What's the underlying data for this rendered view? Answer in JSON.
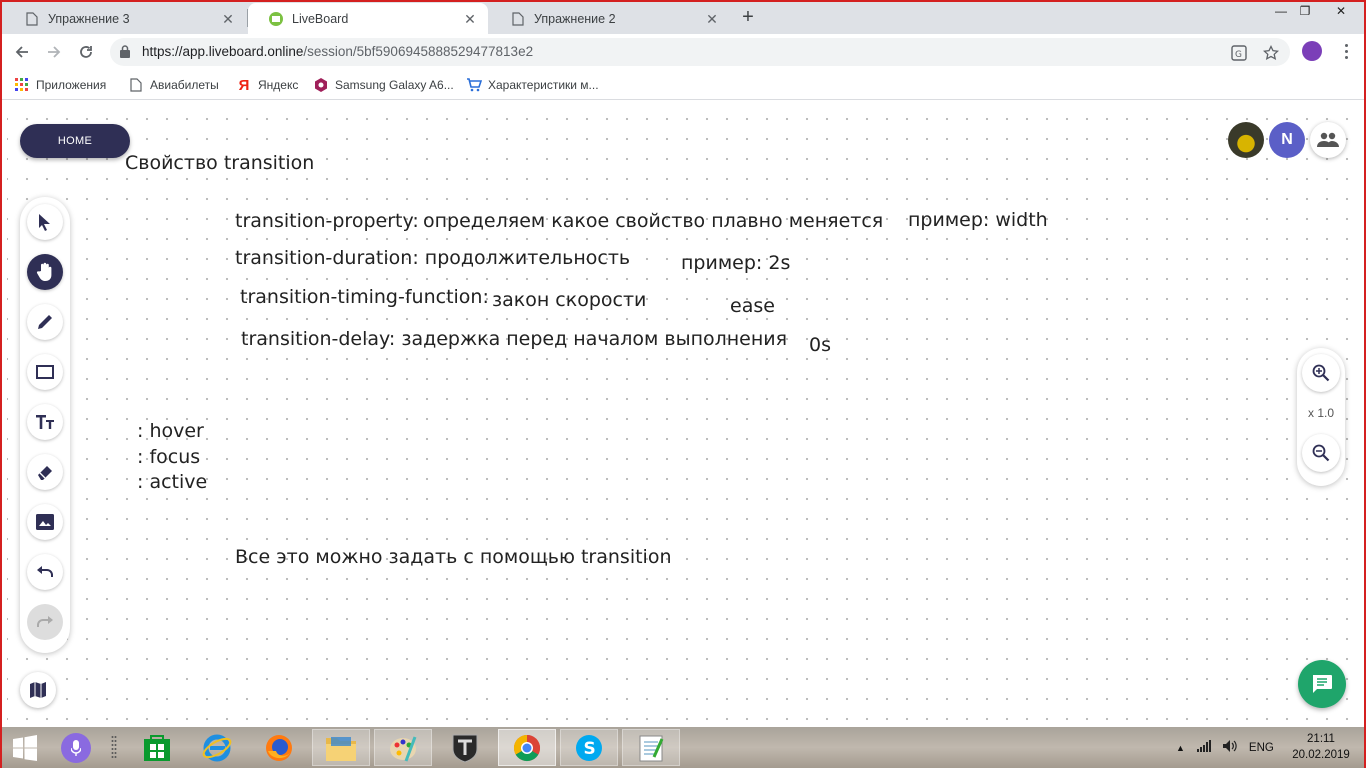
{
  "browser": {
    "tabs": [
      {
        "title": "Упражнение 3",
        "active": false
      },
      {
        "title": "LiveBoard",
        "active": true
      },
      {
        "title": "Упражнение 2",
        "active": false
      }
    ],
    "url_host": "https://app.liveboard.online",
    "url_path": "/session/5bf5906945888529477813e2",
    "bookmarks": [
      {
        "label": "Приложения",
        "icon": "apps-grid-icon"
      },
      {
        "label": "Авиабилеты",
        "icon": "page-icon"
      },
      {
        "label": "Яндекс",
        "icon": "yandex-icon"
      },
      {
        "label": "Samsung Galaxy A6...",
        "icon": "samsung-icon"
      },
      {
        "label": "Характеристики м...",
        "icon": "cart-icon"
      }
    ]
  },
  "app": {
    "home_label": "HOME",
    "avatar_initial": "N",
    "zoom_level": "x 1.0",
    "colors": {
      "primary": "#2f2f55",
      "chat": "#1fa56b",
      "avatar": "#5b5fc7"
    }
  },
  "board": {
    "title": "Свойство transition",
    "rows": [
      {
        "prop": "transition-property:",
        "desc": "определяем какое свойство плавно меняется",
        "example": "пример: width"
      },
      {
        "prop": "transition-duration: продолжительность",
        "example": "пример: 2s"
      },
      {
        "prop": "transition-timing-function:",
        "desc": "закон скорости",
        "example": "ease"
      },
      {
        "prop": "transition-delay: задержка перед началом выполнения",
        "example": "0s"
      }
    ],
    "states": [
      ": hover",
      ": focus",
      ": active"
    ],
    "footer": "Все это можно задать с помощью transition"
  },
  "tools": [
    "select-arrow",
    "hand",
    "pencil",
    "rectangle",
    "text",
    "eraser",
    "image",
    "undo",
    "redo"
  ],
  "taskbar": {
    "lang": "ENG",
    "time": "21:11",
    "date": "20.02.2019"
  }
}
